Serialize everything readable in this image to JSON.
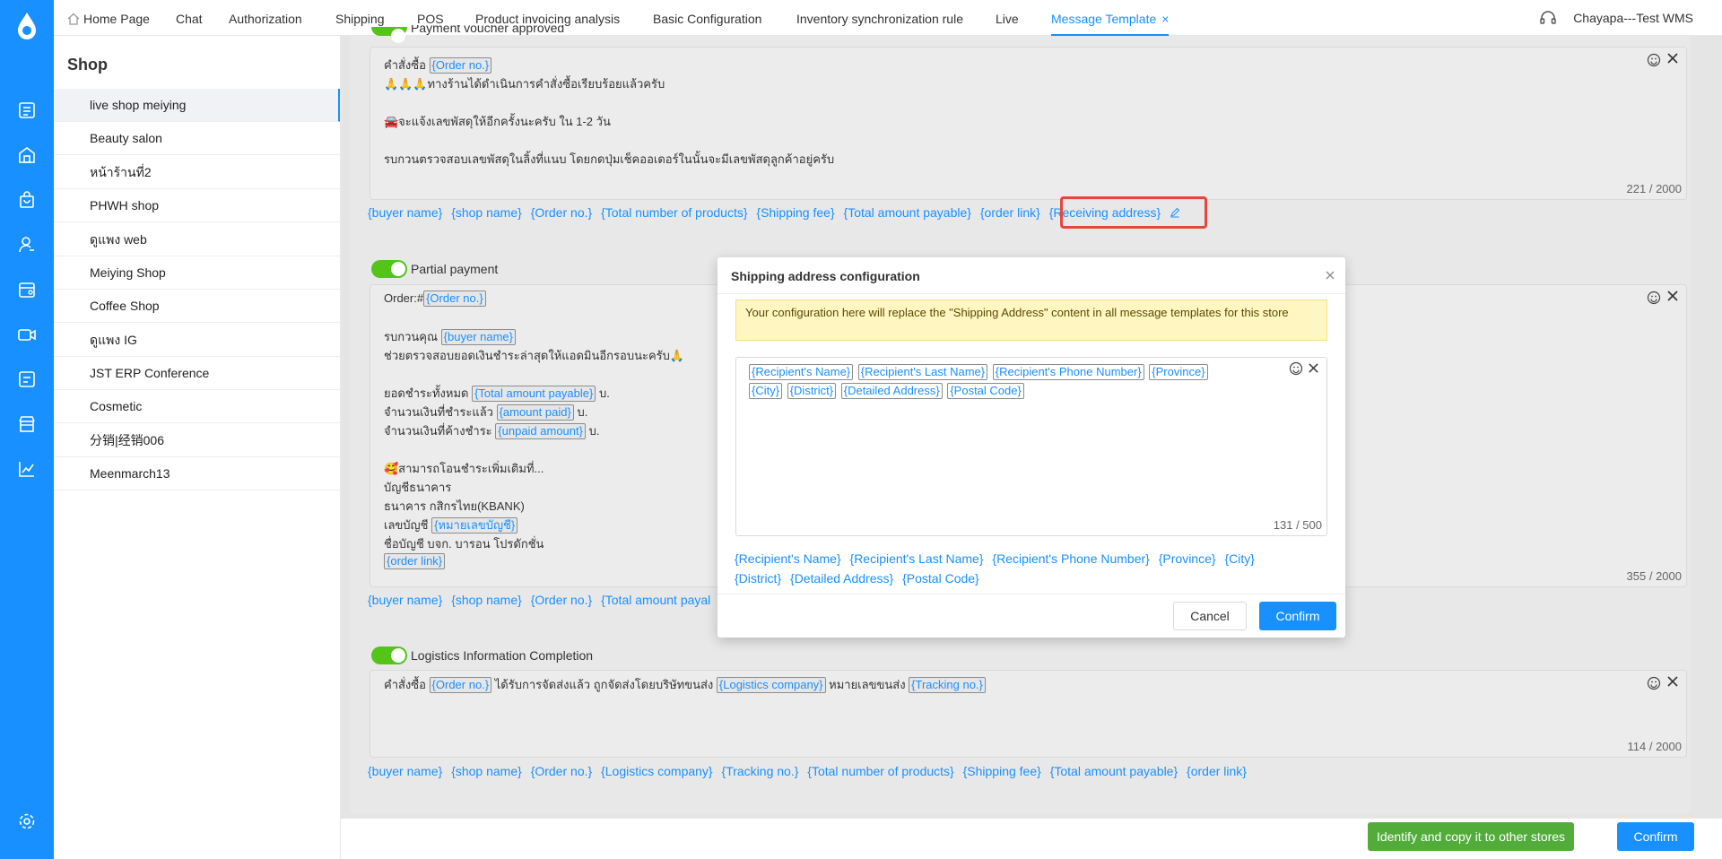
{
  "tabs": [
    {
      "label": "Home Page"
    },
    {
      "label": "Chat"
    },
    {
      "label": "Authorization"
    },
    {
      "label": "Shipping"
    },
    {
      "label": "POS"
    },
    {
      "label": "Product invoicing analysis"
    },
    {
      "label": "Basic Configuration"
    },
    {
      "label": "Inventory synchronization rule"
    },
    {
      "label": "Live"
    },
    {
      "label": "Message Template"
    }
  ],
  "active_tab_close": "×",
  "user": "Chayapa---Test WMS",
  "shop_panel": {
    "title": "Shop",
    "items": [
      "live shop meiying",
      "Beauty salon",
      "หน้าร้านที่2",
      "PHWH shop",
      "ดูแพง web",
      "Meiying Shop",
      "Coffee Shop",
      "ดูแพง IG",
      "JST ERP Conference",
      "Cosmetic",
      "分销|经销006",
      "Meenmarch13"
    ]
  },
  "section1": {
    "title": "Payment voucher approved",
    "lines": [
      {
        "pre": "คำสั่งซื้อ ",
        "chip": "{Order no.}",
        "post": ""
      },
      {
        "pre": "🙏🙏🙏ทางร้านได้ดำเนินการคำสั่งซื้อเรียบร้อยแล้วครับ",
        "chip": "",
        "post": ""
      },
      {
        "pre": "🚘จะแจ้งเลขพัสดุให้อีกครั้งนะครับ ใน 1-2 วัน",
        "chip": "",
        "post": ""
      },
      {
        "pre": "รบกวนตรวจสอบเลขพัสดุในลิ้งที่แนบ โดยกดปุ่มเช็คออเดอร์ในนั้นจะมีเลขพัสดุลูกค้าอยู่ครับ",
        "chip": "",
        "post": ""
      }
    ],
    "count": "221 / 2000",
    "vars": [
      "{buyer name}",
      "{shop name}",
      "{Order no.}",
      "{Total number of products}",
      "{Shipping fee}",
      "{Total amount payable}",
      "{order link}"
    ],
    "highlight_var": "{Receiving address}"
  },
  "section2": {
    "title": "Partial payment",
    "lines": [
      {
        "pre": "Order:#",
        "chip": "{Order no.}",
        "post": ""
      },
      {
        "pre": "รบกวนคุณ ",
        "chip": "{buyer name}",
        "post": ""
      },
      {
        "pre": "ช่วยตรวจสอบยอดเงินชำระล่าสุดให้แอดมินอีกรอบนะครับ🙏",
        "chip": "",
        "post": ""
      },
      {
        "pre": "ยอดชำระทั้งหมด ",
        "chip": "{Total amount payable}",
        "post": " บ."
      },
      {
        "pre": "จำนวนเงินที่ชำระแล้ว ",
        "chip": "{amount paid}",
        "post": " บ."
      },
      {
        "pre": "จำนวนเงินที่ค้างชำระ ",
        "chip": "{unpaid amount}",
        "post": " บ."
      },
      {
        "pre": "🥰สามารถโอนชำระเพิ่มเติมที่...",
        "chip": "",
        "post": ""
      },
      {
        "pre": "บัญชีธนาคาร",
        "chip": "",
        "post": ""
      },
      {
        "pre": "ธนาคาร กสิกรไทย(KBANK)",
        "chip": "",
        "post": ""
      },
      {
        "pre": "เลขบัญชี ",
        "chip": "{หมายเลขบัญชี}",
        "post": ""
      },
      {
        "pre": "ชื่อบัญชี  บจก. บารอน โปรดักชั่น",
        "chip": "",
        "post": ""
      },
      {
        "pre": "",
        "chip": "{order link}",
        "post": ""
      }
    ],
    "count": "355 / 2000",
    "vars": [
      "{buyer name}",
      "{shop name}",
      "{Order no.}",
      "{Total amount payal"
    ]
  },
  "section3": {
    "title": "Logistics Information Completion",
    "line": {
      "a": "คำสั่งซื้อ ",
      "chip1": "{Order no.}",
      "b": " ได้รับการจัดส่งแล้ว ถูกจัดส่งโดยบริษัทขนส่ง ",
      "chip2": "{Logistics company}",
      "c": " หมายเลขขนส่ง ",
      "chip3": "{Tracking no.}"
    },
    "count": "114 / 2000",
    "vars": [
      "{buyer name}",
      "{shop name}",
      "{Order no.}",
      "{Logistics company}",
      "{Tracking no.}",
      "{Total number of products}",
      "{Shipping fee}",
      "{Total amount payable}",
      "{order link}"
    ]
  },
  "footer": {
    "copy_label": "Identify and copy it to other stores",
    "confirm_label": "Confirm"
  },
  "modal": {
    "title": "Shipping address configuration",
    "notice": "Your configuration here will replace the \"Shipping Address\" content in all message templates for this store",
    "chips": [
      "{Recipient's Name}",
      "{Recipient's Last Name}",
      "{Recipient's Phone Number}",
      "{Province}",
      "{City}",
      "{District}",
      "{Detailed Address}",
      "{Postal Code}"
    ],
    "count": "131 / 500",
    "vars": [
      "{Recipient's Name}",
      "{Recipient's Last Name}",
      "{Recipient's Phone Number}",
      "{Province}",
      "{City}",
      "{District}",
      "{Detailed Address}",
      "{Postal Code}"
    ],
    "cancel_label": "Cancel",
    "confirm_label": "Confirm"
  },
  "colors": {
    "primary": "#1890ff",
    "toggle_on": "#52c41a",
    "copy_button": "#52ac3a",
    "highlight": "#e8453c"
  }
}
